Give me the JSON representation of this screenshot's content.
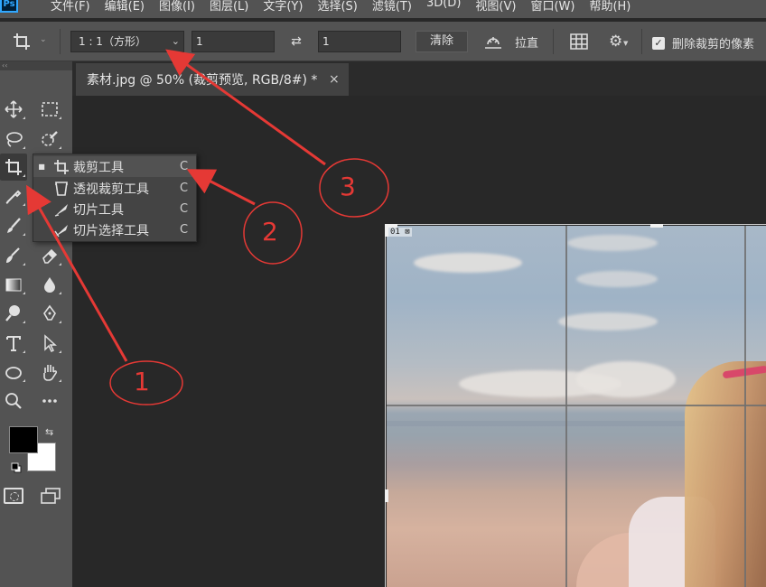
{
  "app": {
    "logo": "Ps"
  },
  "menu": [
    "文件(F)",
    "编辑(E)",
    "图像(I)",
    "图层(L)",
    "文字(Y)",
    "选择(S)",
    "滤镜(T)",
    "3D(D)",
    "视图(V)",
    "窗口(W)",
    "帮助(H)"
  ],
  "options": {
    "ratio_value": "1 : 1（方形）",
    "width_value": "1",
    "height_value": "1",
    "clear_label": "清除",
    "straighten_label": "拉直",
    "delete_pixels_label": "删除裁剪的像素",
    "delete_pixels_checked": true
  },
  "toolbar": {
    "grip": "‹‹"
  },
  "flyout": {
    "items": [
      {
        "label": "裁剪工具",
        "shortcut": "C",
        "selected": true,
        "icon": "crop-icon"
      },
      {
        "label": "透视裁剪工具",
        "shortcut": "C",
        "selected": false,
        "icon": "perspective-crop-icon"
      },
      {
        "label": "切片工具",
        "shortcut": "C",
        "selected": false,
        "icon": "slice-icon"
      },
      {
        "label": "切片选择工具",
        "shortcut": "C",
        "selected": false,
        "icon": "slice-select-icon"
      }
    ]
  },
  "document": {
    "tab_title": "素材.jpg @ 50% (裁剪预览, RGB/8#) *",
    "close": "×",
    "photo_label": "01 ⊠"
  },
  "colors": {
    "foreground": "#000000",
    "background": "#ffffff",
    "annotation": "#e53935"
  },
  "annotations": [
    "1",
    "2",
    "3"
  ]
}
